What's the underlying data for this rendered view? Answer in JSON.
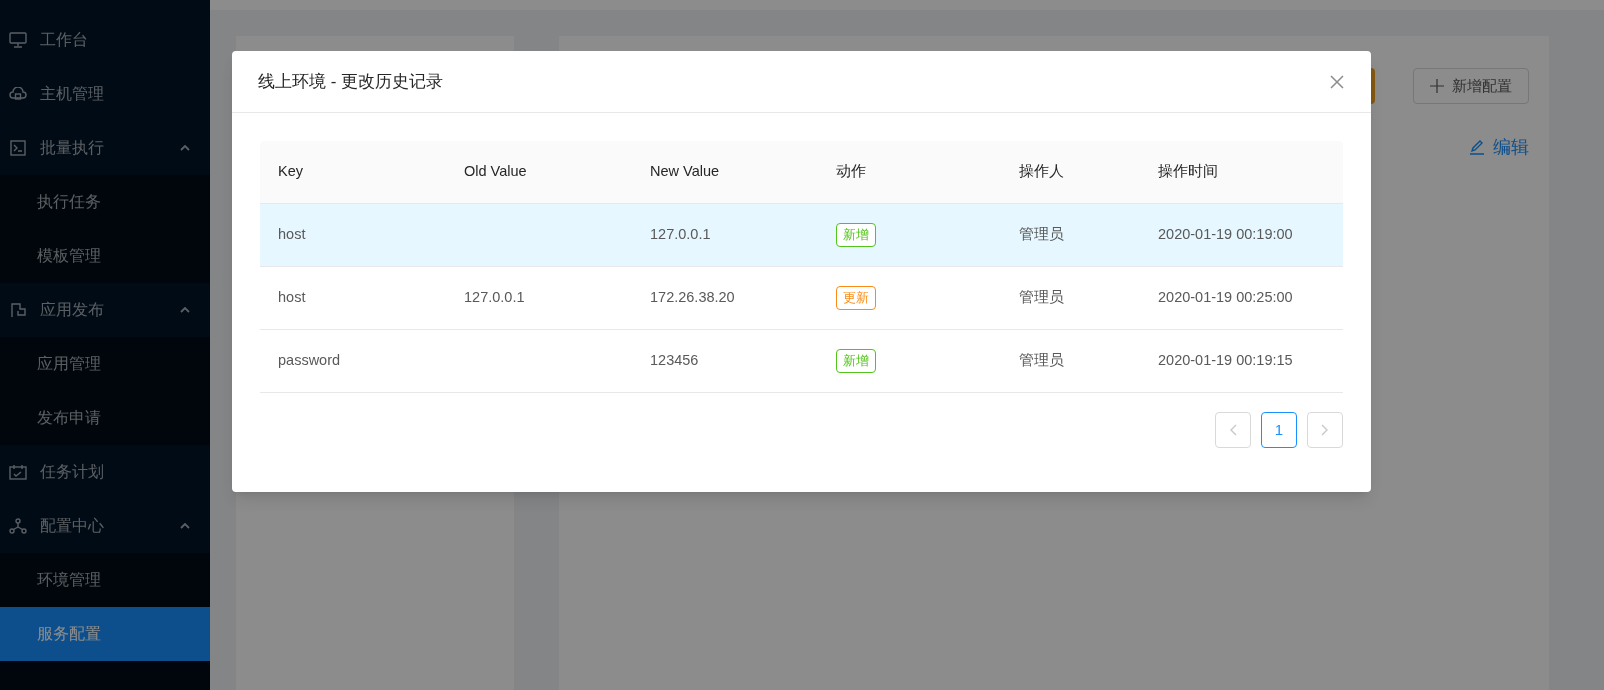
{
  "sidebar": {
    "items": [
      {
        "label": "工作台",
        "selected": false
      },
      {
        "label": "主机管理",
        "selected": false
      },
      {
        "label": "批量执行",
        "expanded": true,
        "children": [
          {
            "label": "执行任务",
            "selected": false
          },
          {
            "label": "模板管理",
            "selected": false
          }
        ]
      },
      {
        "label": "应用发布",
        "expanded": true,
        "children": [
          {
            "label": "应用管理",
            "selected": false
          },
          {
            "label": "发布申请",
            "selected": false
          }
        ]
      },
      {
        "label": "任务计划",
        "selected": false
      },
      {
        "label": "配置中心",
        "expanded": true,
        "children": [
          {
            "label": "环境管理",
            "selected": false
          },
          {
            "label": "服务配置",
            "selected": true
          }
        ]
      }
    ]
  },
  "page": {
    "add_button": "新增配置",
    "edit_link": "编辑"
  },
  "modal": {
    "title": "线上环境 - 更改历史记录",
    "table": {
      "columns": [
        "Key",
        "Old Value",
        "New Value",
        "动作",
        "操作人",
        "操作时间"
      ],
      "rows": [
        {
          "selected": true,
          "cells": [
            "host",
            "",
            "127.0.0.1",
            {
              "text": "新增",
              "color": "#52c41a"
            },
            "管理员",
            "2020-01-19 00:19:00"
          ]
        },
        {
          "selected": false,
          "cells": [
            "host",
            "127.0.0.1",
            "172.26.38.20",
            {
              "text": "更新",
              "color": "#fa8c16"
            },
            "管理员",
            "2020-01-19 00:25:00"
          ]
        },
        {
          "selected": false,
          "cells": [
            "password",
            "",
            "123456",
            {
              "text": "新增",
              "color": "#52c41a"
            },
            "管理员",
            "2020-01-19 00:19:15"
          ]
        }
      ]
    },
    "pagination": {
      "prev": {
        "disabled": true
      },
      "pages": [
        {
          "label": "1",
          "selected": true
        }
      ],
      "next": {
        "disabled": true
      }
    }
  }
}
